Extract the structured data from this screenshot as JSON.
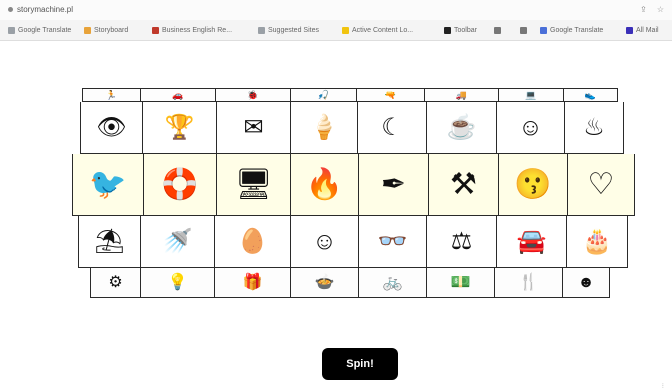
{
  "browser": {
    "url": "storymachine.pl",
    "bookmarks": [
      {
        "label": "Google Translate",
        "color": "#9aa0a6"
      },
      {
        "label": "Storyboard",
        "color": "#e8a33a"
      },
      {
        "label": "Business English Re...",
        "color": "#c0392b"
      },
      {
        "label": "Suggested Sites",
        "color": "#9aa0a6"
      },
      {
        "label": "Active Content Lo...",
        "color": "#f1c40f"
      },
      {
        "label": "Toolbar",
        "color": "#222222"
      },
      {
        "label": "",
        "color": "#777777"
      },
      {
        "label": "",
        "color": "#777777"
      },
      {
        "label": "Google Translate",
        "color": "#4a6fd8"
      },
      {
        "label": "All Mail",
        "color": "#3a2fb8"
      }
    ]
  },
  "reels": {
    "rows": [
      {
        "cells": [
          {
            "icon": "running-person-icon",
            "glyph": "🏃"
          },
          {
            "icon": "car-icon",
            "glyph": "🚗"
          },
          {
            "icon": "bugs-icon",
            "glyph": "🐞"
          },
          {
            "icon": "fishing-icon",
            "glyph": "🎣"
          },
          {
            "icon": "rifle-icon",
            "glyph": "🔫"
          },
          {
            "icon": "truck-icon",
            "glyph": "🚚"
          },
          {
            "icon": "laptop-icon",
            "glyph": "💻"
          },
          {
            "icon": "shoe-icon",
            "glyph": "👟"
          }
        ]
      },
      {
        "cells": [
          {
            "icon": "eye-icon",
            "glyph": "👁"
          },
          {
            "icon": "trophy-icon",
            "glyph": "🏆"
          },
          {
            "icon": "envelope-icon",
            "glyph": "✉"
          },
          {
            "icon": "ice-cream-icon",
            "glyph": "🍦"
          },
          {
            "icon": "crescent-moon-icon",
            "glyph": "☾"
          },
          {
            "icon": "coffee-cup-icon",
            "glyph": "☕"
          },
          {
            "icon": "smiley-icon",
            "glyph": "☺"
          },
          {
            "icon": "washing-icon",
            "glyph": "♨"
          }
        ]
      },
      {
        "cells": [
          {
            "icon": "kiwi-bird-icon",
            "glyph": "🐦"
          },
          {
            "icon": "life-ring-icon",
            "glyph": "🛟"
          },
          {
            "icon": "monitor-icon",
            "glyph": "🖥"
          },
          {
            "icon": "fire-icon",
            "glyph": "🔥"
          },
          {
            "icon": "pen-icon",
            "glyph": "✒"
          },
          {
            "icon": "tools-icon",
            "glyph": "⚒"
          },
          {
            "icon": "whistle-face-icon",
            "glyph": "😗"
          },
          {
            "icon": "heart-icon",
            "glyph": "♡"
          }
        ]
      },
      {
        "cells": [
          {
            "icon": "beach-umbrella-icon",
            "glyph": "⛱"
          },
          {
            "icon": "shower-icon",
            "glyph": "🚿"
          },
          {
            "icon": "egg-icon",
            "glyph": "🥚"
          },
          {
            "icon": "smiley-icon",
            "glyph": "☺"
          },
          {
            "icon": "glasses-icon",
            "glyph": "👓"
          },
          {
            "icon": "scales-icon",
            "glyph": "⚖"
          },
          {
            "icon": "car-icon",
            "glyph": "🚘"
          },
          {
            "icon": "birthday-cake-icon",
            "glyph": "🎂"
          }
        ]
      },
      {
        "cells": [
          {
            "icon": "gear-icon",
            "glyph": "⚙"
          },
          {
            "icon": "lightbulb-icon",
            "glyph": "💡"
          },
          {
            "icon": "gifts-icon",
            "glyph": "🎁"
          },
          {
            "icon": "bowl-icon",
            "glyph": "🍲"
          },
          {
            "icon": "bicycle-icon",
            "glyph": "🚲"
          },
          {
            "icon": "money-icon",
            "glyph": "💵"
          },
          {
            "icon": "cutlery-icon",
            "glyph": "🍴"
          },
          {
            "icon": "emoji-icon",
            "glyph": "☻"
          }
        ]
      }
    ]
  },
  "spin_button": {
    "label": "Spin!"
  }
}
